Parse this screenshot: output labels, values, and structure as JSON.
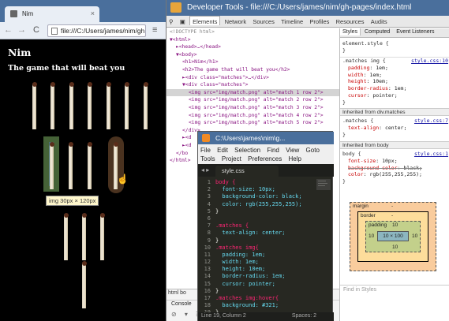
{
  "chrome": {
    "tab_title": "Nim",
    "tab_close": "×",
    "back": "←",
    "forward": "→",
    "reload": "C",
    "url": "file:///C:/Users/james/nim/gh",
    "menu": "≡"
  },
  "page": {
    "h1": "Nim",
    "h2": "The game that will beat you",
    "tooltip": "img 30px × 120px",
    "rows": [
      7,
      5,
      3,
      1
    ]
  },
  "devtools": {
    "title": "Developer Tools - file:///C:/Users/james/nim/gh-pages/index.html",
    "tabs": [
      "Elements",
      "Network",
      "Sources",
      "Timeline",
      "Profiles",
      "Resources",
      "Audits"
    ],
    "winbtns": [
      "—",
      "□",
      "✕"
    ],
    "dom": [
      {
        "indent": 0,
        "text": "<!DOCTYPE html>",
        "cls": "doctype"
      },
      {
        "indent": 0,
        "text": "▼<html>"
      },
      {
        "indent": 1,
        "text": "►<head>…</head>"
      },
      {
        "indent": 1,
        "text": "▼<body>"
      },
      {
        "indent": 2,
        "text": "<h1>Nim</h1>"
      },
      {
        "indent": 2,
        "text": "<h2>The game that will beat you</h2>"
      },
      {
        "indent": 2,
        "text": "►<div class=\"matches\">…</div>"
      },
      {
        "indent": 2,
        "text": "▼<div class=\"matches\">"
      },
      {
        "indent": 3,
        "text": "<img src=\"img/match.png\" alt=\"match 1 row 2\">",
        "sel": true
      },
      {
        "indent": 3,
        "text": "<img src=\"img/match.png\" alt=\"match 2 row 2\">"
      },
      {
        "indent": 3,
        "text": "<img src=\"img/match.png\" alt=\"match 3 row 2\">"
      },
      {
        "indent": 3,
        "text": "<img src=\"img/match.png\" alt=\"match 4 row 2\">"
      },
      {
        "indent": 3,
        "text": "<img src=\"img/match.png\" alt=\"match 5 row 2\">"
      },
      {
        "indent": 2,
        "text": "</div>"
      },
      {
        "indent": 2,
        "text": "►<d"
      },
      {
        "indent": 2,
        "text": "►<d"
      },
      {
        "indent": 1,
        "text": "</bo"
      },
      {
        "indent": 0,
        "text": "</html>"
      }
    ],
    "crumbs": "html   bo",
    "console": "Console",
    "bottom_icons": "⊘ ▾ ☰"
  },
  "styles": {
    "tabs": [
      "Styles",
      "Computed",
      "Event Listeners"
    ],
    "element_style": "element.style {",
    "element_close": "}",
    "rule1": {
      "selector": ".matches img {",
      "source": "style.css:10",
      "props": [
        {
          "n": "padding",
          "v": "1em;"
        },
        {
          "n": "width",
          "v": "1em;"
        },
        {
          "n": "height",
          "v": "10em;"
        },
        {
          "n": "border-radius",
          "v": "1em;"
        },
        {
          "n": "cursor",
          "v": "pointer;"
        }
      ],
      "close": "}"
    },
    "inherited1": "Inherited from div.matches",
    "rule2": {
      "selector": ".matches {",
      "source": "style.css:7",
      "props": [
        {
          "n": "text-align",
          "v": "center;"
        }
      ],
      "close": "}"
    },
    "inherited2": "Inherited from body",
    "rule3": {
      "selector": "body {",
      "source": "style.css:1",
      "props": [
        {
          "n": "font-size",
          "v": "10px;"
        },
        {
          "n": "background-color",
          "v": "black;"
        },
        {
          "n": "color",
          "v": "rgb(255,255,255);"
        }
      ],
      "close": "}"
    },
    "boxmodel": {
      "margin": "margin",
      "border": "border",
      "padding": "padding",
      "padding_val": "10",
      "content": "10 × 100",
      "dash": "-"
    },
    "find": "Find in Styles"
  },
  "sublime": {
    "title": "C:\\Users\\james\\nim\\g...",
    "menu_row1": [
      "File",
      "Edit",
      "Selection",
      "Find",
      "View",
      "Goto"
    ],
    "menu_row2": [
      "Tools",
      "Project",
      "Preferences",
      "Help"
    ],
    "file_tab": "style.css",
    "tab_close": "×",
    "status_left": "Line 19, Column 2",
    "status_right": "Spaces: 2",
    "code": [
      {
        "n": "1",
        "t": "body {",
        "k": "sel"
      },
      {
        "n": "2",
        "t": "  font-size: 10px;",
        "k": "prop"
      },
      {
        "n": "3",
        "t": "  background-color: black;",
        "k": "prop"
      },
      {
        "n": "4",
        "t": "  color: rgb(255,255,255);",
        "k": "prop"
      },
      {
        "n": "5",
        "t": "}",
        "k": "plain"
      },
      {
        "n": "6",
        "t": "",
        "k": "plain"
      },
      {
        "n": "7",
        "t": ".matches {",
        "k": "sel"
      },
      {
        "n": "8",
        "t": "  text-align: center;",
        "k": "prop"
      },
      {
        "n": "9",
        "t": "}",
        "k": "plain"
      },
      {
        "n": "10",
        "t": ".matches img{",
        "k": "sel"
      },
      {
        "n": "11",
        "t": "  padding: 1em;",
        "k": "prop"
      },
      {
        "n": "12",
        "t": "  width: 1em;",
        "k": "prop"
      },
      {
        "n": "13",
        "t": "  height: 10em;",
        "k": "prop"
      },
      {
        "n": "14",
        "t": "  border-radius: 1em;",
        "k": "prop"
      },
      {
        "n": "15",
        "t": "  cursor: pointer;",
        "k": "prop"
      },
      {
        "n": "16",
        "t": "}",
        "k": "plain"
      },
      {
        "n": "17",
        "t": ".matches img:hover{",
        "k": "sel"
      },
      {
        "n": "18",
        "t": "  background: #321;",
        "k": "prop"
      },
      {
        "n": "19",
        "t": "}",
        "k": "plain"
      }
    ]
  },
  "colors": {
    "page_bg": "#000000",
    "hover_bg": "#332211",
    "titlebar": "#4a6f9c",
    "sublime_bg": "#272822"
  }
}
